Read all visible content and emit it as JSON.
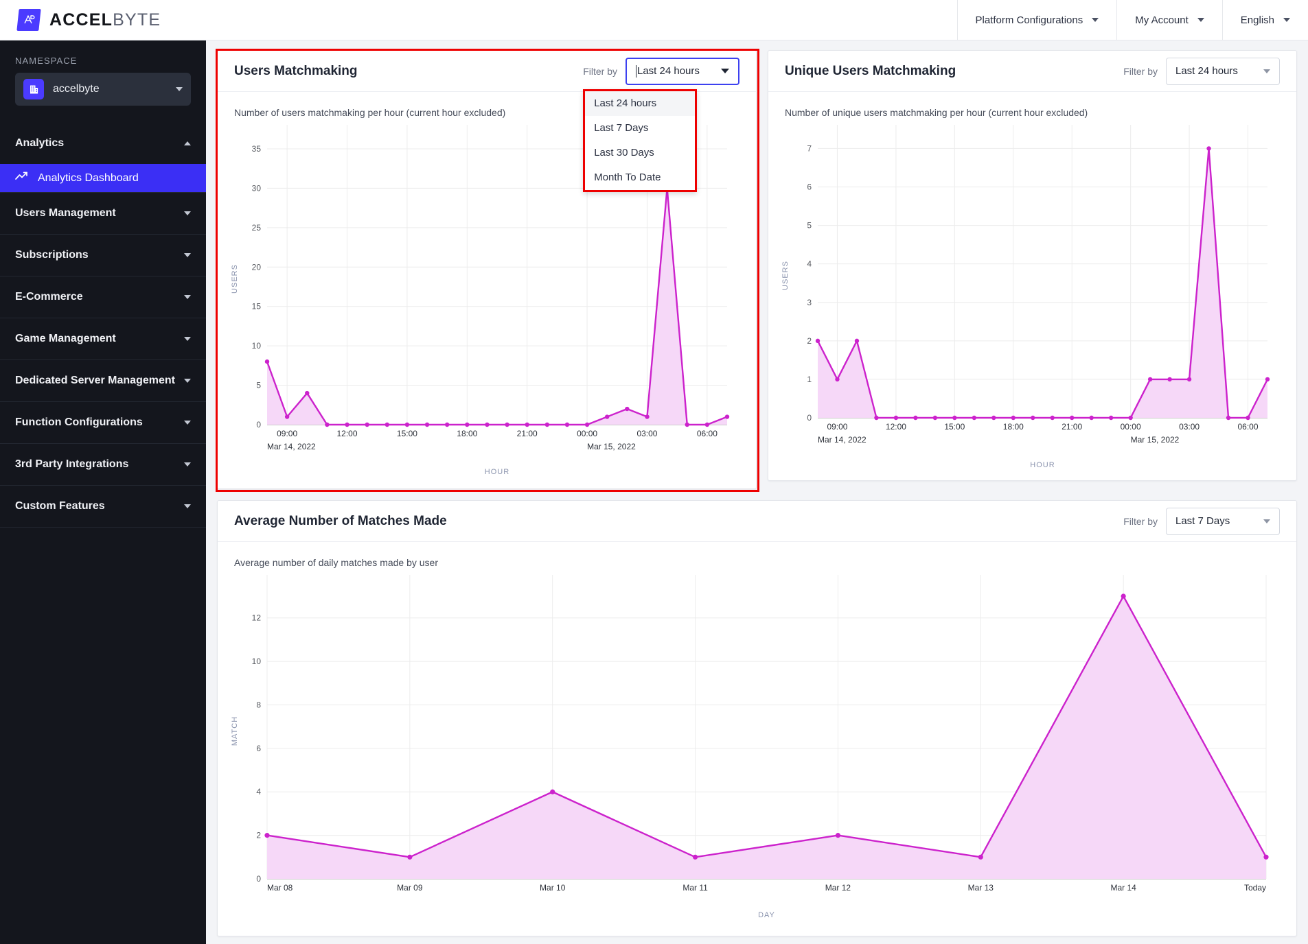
{
  "header": {
    "brand_bold": "ACCEL",
    "brand_light": "BYTE",
    "logo_icon": "accelbyte-logo-icon",
    "items": [
      {
        "label": "Platform Configurations",
        "icon": "chevron-down-icon"
      },
      {
        "label": "My Account",
        "icon": "chevron-down-icon"
      },
      {
        "label": "English",
        "icon": "chevron-down-icon"
      }
    ]
  },
  "sidebar": {
    "namespace_label": "NAMESPACE",
    "namespace_value": "accelbyte",
    "namespace_icon": "building-icon",
    "groups": [
      {
        "label": "Analytics",
        "expanded": true,
        "icon": "chevron-up-icon"
      },
      {
        "label": "Users Management",
        "expanded": false,
        "icon": "chevron-down-icon"
      },
      {
        "label": "Subscriptions",
        "expanded": false,
        "icon": "chevron-down-icon"
      },
      {
        "label": "E-Commerce",
        "expanded": false,
        "icon": "chevron-down-icon"
      },
      {
        "label": "Game Management",
        "expanded": false,
        "icon": "chevron-down-icon"
      },
      {
        "label": "Dedicated Server Management",
        "expanded": false,
        "icon": "chevron-down-icon"
      },
      {
        "label": "Function Configurations",
        "expanded": false,
        "icon": "chevron-down-icon"
      },
      {
        "label": "3rd Party Integrations",
        "expanded": false,
        "icon": "chevron-down-icon"
      },
      {
        "label": "Custom Features",
        "expanded": false,
        "icon": "chevron-down-icon"
      }
    ],
    "active_item": {
      "label": "Analytics Dashboard",
      "icon": "trend-up-icon"
    }
  },
  "filter": {
    "label": "Filter by",
    "options": [
      "Last 24 hours",
      "Last 7 Days",
      "Last 30 Days",
      "Month To Date"
    ],
    "open_selected": "Last 24 hours"
  },
  "cards": {
    "users_matchmaking": {
      "title": "Users Matchmaking",
      "subtitle": "Number of users matchmaking per hour (current hour excluded)",
      "filter_value": "Last 24 hours",
      "dropdown_open": true,
      "highlighted": true
    },
    "unique_users_matchmaking": {
      "title": "Unique Users Matchmaking",
      "subtitle": "Number of unique users matchmaking per hour (current hour excluded)",
      "filter_value": "Last 24 hours",
      "dropdown_open": false,
      "highlighted": false
    },
    "average_matches": {
      "title": "Average Number of Matches Made",
      "subtitle": "Average number of daily matches made by user",
      "filter_value": "Last 7 Days",
      "dropdown_open": false,
      "highlighted": false
    }
  },
  "colors": {
    "line": "#cc22cc",
    "area": "#f6d8f8",
    "accent_blue": "#3b2ff5",
    "highlight_red": "#ee0000",
    "sidebar_bg": "#14161d",
    "page_bg": "#f3f4f7"
  },
  "chart_data": [
    {
      "id": "users-matchmaking-chart",
      "type": "area",
      "title": "Number of users matchmaking per hour (current hour excluded)",
      "xlabel": "HOUR",
      "ylabel": "USERS",
      "ylim": [
        0,
        37
      ],
      "yticks": [
        0,
        5,
        10,
        15,
        20,
        25,
        30,
        35
      ],
      "grid": true,
      "xticks": [
        "09:00",
        "12:00",
        "15:00",
        "18:00",
        "21:00",
        "00:00",
        "03:00",
        "06:00"
      ],
      "xtick_positions": [
        1,
        4,
        7,
        10,
        13,
        16,
        19,
        22
      ],
      "date_boundaries": [
        {
          "label": "Mar 14, 2022",
          "index": 0
        },
        {
          "label": "Mar 15, 2022",
          "index": 16
        }
      ],
      "x": [
        "08:00",
        "09:00",
        "10:00",
        "11:00",
        "12:00",
        "13:00",
        "14:00",
        "15:00",
        "16:00",
        "17:00",
        "18:00",
        "19:00",
        "20:00",
        "21:00",
        "22:00",
        "23:00",
        "00:00",
        "01:00",
        "02:00",
        "03:00",
        "04:00",
        "05:00",
        "06:00",
        "07:00"
      ],
      "values": [
        8,
        1,
        4,
        0,
        0,
        0,
        0,
        0,
        0,
        0,
        0,
        0,
        0,
        0,
        0,
        0,
        0,
        1,
        2,
        1,
        30,
        0,
        0,
        1
      ]
    },
    {
      "id": "unique-users-matchmaking-chart",
      "type": "area",
      "title": "Number of unique users matchmaking per hour (current hour excluded)",
      "xlabel": "HOUR",
      "ylabel": "USERS",
      "ylim": [
        0,
        7.4
      ],
      "yticks": [
        0,
        1,
        2,
        3,
        4,
        5,
        6,
        7
      ],
      "grid": true,
      "xticks": [
        "09:00",
        "12:00",
        "15:00",
        "18:00",
        "21:00",
        "00:00",
        "03:00",
        "06:00"
      ],
      "xtick_positions": [
        1,
        4,
        7,
        10,
        13,
        16,
        19,
        22
      ],
      "date_boundaries": [
        {
          "label": "Mar 14, 2022",
          "index": 0
        },
        {
          "label": "Mar 15, 2022",
          "index": 16
        }
      ],
      "x": [
        "08:00",
        "09:00",
        "10:00",
        "11:00",
        "12:00",
        "13:00",
        "14:00",
        "15:00",
        "16:00",
        "17:00",
        "18:00",
        "19:00",
        "20:00",
        "21:00",
        "22:00",
        "23:00",
        "00:00",
        "01:00",
        "02:00",
        "03:00",
        "04:00",
        "05:00",
        "06:00",
        "07:00"
      ],
      "values": [
        2,
        1,
        2,
        0,
        0,
        0,
        0,
        0,
        0,
        0,
        0,
        0,
        0,
        0,
        0,
        0,
        0,
        1,
        1,
        1,
        7,
        0,
        0,
        1
      ]
    },
    {
      "id": "average-matches-chart",
      "type": "area",
      "title": "Average number of daily matches made by user",
      "xlabel": "DAY",
      "ylabel": "MATCH",
      "ylim": [
        0,
        13.6
      ],
      "yticks": [
        0,
        2,
        4,
        6,
        8,
        10,
        12
      ],
      "grid": true,
      "categories": [
        "Mar 08",
        "Mar 09",
        "Mar 10",
        "Mar 11",
        "Mar 12",
        "Mar 13",
        "Mar 14",
        "Today"
      ],
      "values": [
        2,
        1,
        4,
        1,
        2,
        1,
        13,
        1
      ]
    }
  ]
}
